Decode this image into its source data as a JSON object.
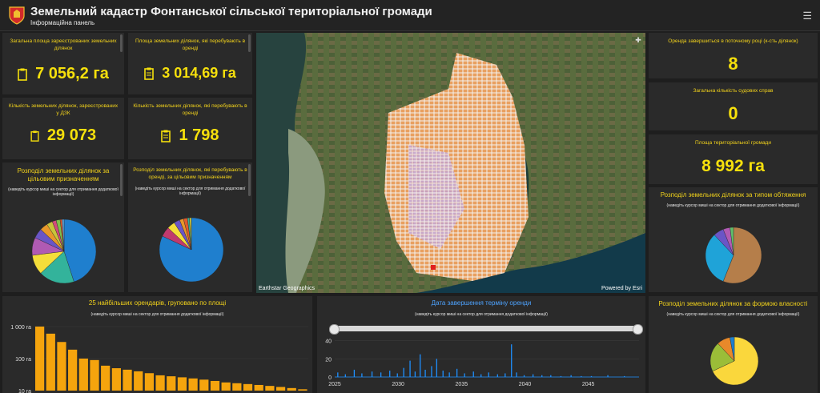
{
  "header": {
    "title": "Земельний кадастр Фонтанської сільської територіальної громади",
    "subtitle": "Інформаційна панель",
    "menu_icon": "hamburger-menu-icon"
  },
  "colors": {
    "accent": "#f6e00c",
    "title": "#f2d21b",
    "panel": "#2a2a2a",
    "bg": "#1e1e1e",
    "bar": "#f5a40d",
    "line": "#1e90ff"
  },
  "kpis": {
    "total_area": {
      "label": "Загальна площа зареєстрованих земельних ділянок",
      "value": "7 056,2 га",
      "icon": "document-icon"
    },
    "leased_area": {
      "label": "Площа земельних ділянок, які перебувають в оренді",
      "value": "3 014,69 га",
      "icon": "document-icon"
    },
    "parcels_count": {
      "label": "Кількість земельних ділянок, зареєстрованих у ДЗК",
      "value": "29 073",
      "icon": "document-icon"
    },
    "leased_count": {
      "label": "Кількість земельних ділянок, які перебувають в оренді",
      "value": "1 798",
      "icon": "document-icon"
    },
    "leases_ending": {
      "label": "Оренда завершиться в поточному році (к-сть ділянок)",
      "value": "8"
    },
    "court_cases": {
      "label": "Загальна кількість судових справ",
      "value": "0"
    },
    "community_area": {
      "label": "Площа територіальної громади",
      "value": "8 992 га"
    }
  },
  "panels": {
    "purpose": {
      "title": "Розподіл земельних ділянок за цільовим призначенням",
      "hint": "(наведіть курсор миші на сектор для отримання додаткової інформації)"
    },
    "lease_purpose": {
      "title": "Розподіл земельних ділянок, які перебувають в оренді, за цільовим призначенням",
      "hint": "(наведіть курсор миші на сектор для отримання додаткової інформації)"
    },
    "encumbrance": {
      "title": "Розподіл земельних ділянок за типом обтяження",
      "hint": "(наведіть курсор миші на сектор для отримання додаткової інформації)"
    },
    "ownership": {
      "title": "Розподіл земельних ділянок за формою власності",
      "hint": "(наведіть курсор миші на сектор для отримання додаткової інформації)"
    },
    "top25": {
      "title": "25 найбільших орендарів, групованo по площі",
      "hint": "(наведіть курсор миші на сектор для отримання додаткової інформації)"
    },
    "lease_end": {
      "title": "Дата завершення терміну оренди",
      "hint": "(наведіть курсор миші на сектор для отримання додаткової інформації)"
    }
  },
  "map": {
    "attribution_left": "Earthstar Geographics",
    "attribution_right": "Powered by Esri"
  },
  "chart_data": [
    {
      "type": "pie",
      "id": "purpose",
      "values": [
        45,
        18,
        10,
        9,
        5,
        4,
        3,
        2,
        2,
        1,
        1
      ],
      "colors": [
        "#1f7fce",
        "#33b39b",
        "#f4de3a",
        "#b05ab3",
        "#6a55c6",
        "#e8982a",
        "#c8c43a",
        "#d34a7c",
        "#7fbf4a",
        "#e05a2c",
        "#58a6e0"
      ]
    },
    {
      "type": "pie",
      "id": "lease_purpose",
      "values": [
        82,
        5,
        4,
        3,
        2,
        2,
        1,
        1
      ],
      "colors": [
        "#1f7fce",
        "#c03a6e",
        "#f4de3a",
        "#6a55c6",
        "#e8982a",
        "#e05a2c",
        "#33b39b",
        "#c8c43a"
      ]
    },
    {
      "type": "pie",
      "id": "encumbrance",
      "values": [
        56,
        32,
        6,
        4,
        2
      ],
      "colors": [
        "#b57e4a",
        "#1fa3d8",
        "#6a55c6",
        "#b05ab3",
        "#5fbf6a"
      ]
    },
    {
      "type": "pie",
      "id": "ownership",
      "values": [
        68,
        20,
        9,
        3
      ],
      "colors": [
        "#fad73c",
        "#9bbd38",
        "#e8892a",
        "#1f7fce"
      ]
    },
    {
      "type": "bar",
      "id": "top25",
      "scale": "log",
      "ylim": [
        10,
        1000
      ],
      "ytick_labels": [
        "1 000 га",
        "100 га",
        "10 га"
      ],
      "yticks": [
        1000,
        100,
        10
      ],
      "values": [
        1000,
        600,
        330,
        190,
        100,
        90,
        60,
        50,
        45,
        40,
        35,
        30,
        28,
        26,
        24,
        22,
        20,
        18,
        17,
        16,
        15,
        14,
        13,
        12,
        11
      ]
    },
    {
      "type": "bar",
      "id": "lease_end",
      "x_tick_labels": [
        "2025",
        "2030",
        "2035",
        "2040",
        "2045"
      ],
      "xticks": [
        2025,
        2030,
        2035,
        2040,
        2045
      ],
      "ytick_labels": [
        "40",
        "20",
        "0"
      ],
      "yticks": [
        40,
        20,
        0
      ],
      "ylim": [
        0,
        45
      ],
      "xlim": [
        2025,
        2049
      ],
      "spikes": [
        [
          2025.2,
          5
        ],
        [
          2025.8,
          3
        ],
        [
          2026.5,
          8
        ],
        [
          2027.1,
          4
        ],
        [
          2027.9,
          6
        ],
        [
          2028.6,
          5
        ],
        [
          2029.3,
          7
        ],
        [
          2029.9,
          4
        ],
        [
          2030.4,
          10
        ],
        [
          2030.9,
          18
        ],
        [
          2031.3,
          6
        ],
        [
          2031.7,
          25
        ],
        [
          2032.1,
          8
        ],
        [
          2032.6,
          12
        ],
        [
          2033.0,
          20
        ],
        [
          2033.5,
          7
        ],
        [
          2034.0,
          5
        ],
        [
          2034.6,
          9
        ],
        [
          2035.2,
          4
        ],
        [
          2035.9,
          6
        ],
        [
          2036.5,
          3
        ],
        [
          2037.1,
          5
        ],
        [
          2037.8,
          3
        ],
        [
          2038.4,
          4
        ],
        [
          2038.9,
          36
        ],
        [
          2039.3,
          5
        ],
        [
          2039.9,
          2
        ],
        [
          2040.6,
          3
        ],
        [
          2041.3,
          2
        ],
        [
          2042.0,
          2
        ],
        [
          2042.8,
          1
        ],
        [
          2043.6,
          2
        ],
        [
          2044.4,
          1
        ],
        [
          2045.2,
          1
        ],
        [
          2046.5,
          2
        ],
        [
          2047.8,
          1
        ]
      ]
    }
  ]
}
